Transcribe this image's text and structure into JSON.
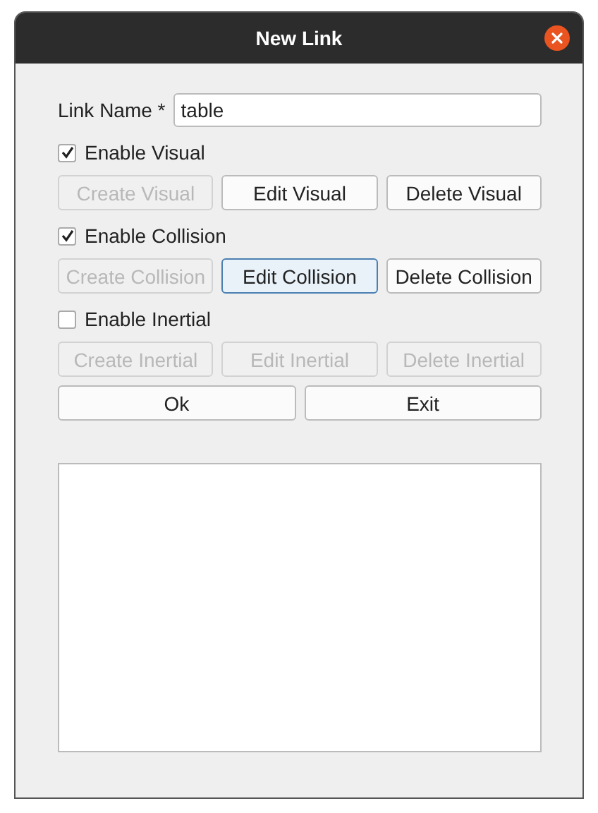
{
  "window": {
    "title": "New Link"
  },
  "name_field": {
    "label": "Link Name *",
    "value": "table"
  },
  "sections": [
    {
      "label": "Enable Visual",
      "checked": true,
      "buttons": [
        {
          "label": "Create Visual",
          "disabled": true,
          "focused": false
        },
        {
          "label": "Edit Visual",
          "disabled": false,
          "focused": false
        },
        {
          "label": "Delete Visual",
          "disabled": false,
          "focused": false
        }
      ]
    },
    {
      "label": "Enable Collision",
      "checked": true,
      "buttons": [
        {
          "label": "Create Collision",
          "disabled": true,
          "focused": false
        },
        {
          "label": "Edit Collision",
          "disabled": false,
          "focused": true
        },
        {
          "label": "Delete Collision",
          "disabled": false,
          "focused": false
        }
      ]
    },
    {
      "label": "Enable Inertial",
      "checked": false,
      "buttons": [
        {
          "label": "Create Inertial",
          "disabled": true,
          "focused": false
        },
        {
          "label": "Edit Inertial",
          "disabled": true,
          "focused": false
        },
        {
          "label": "Delete Inertial",
          "disabled": true,
          "focused": false
        }
      ]
    }
  ],
  "actions": [
    "Ok",
    "Exit"
  ]
}
